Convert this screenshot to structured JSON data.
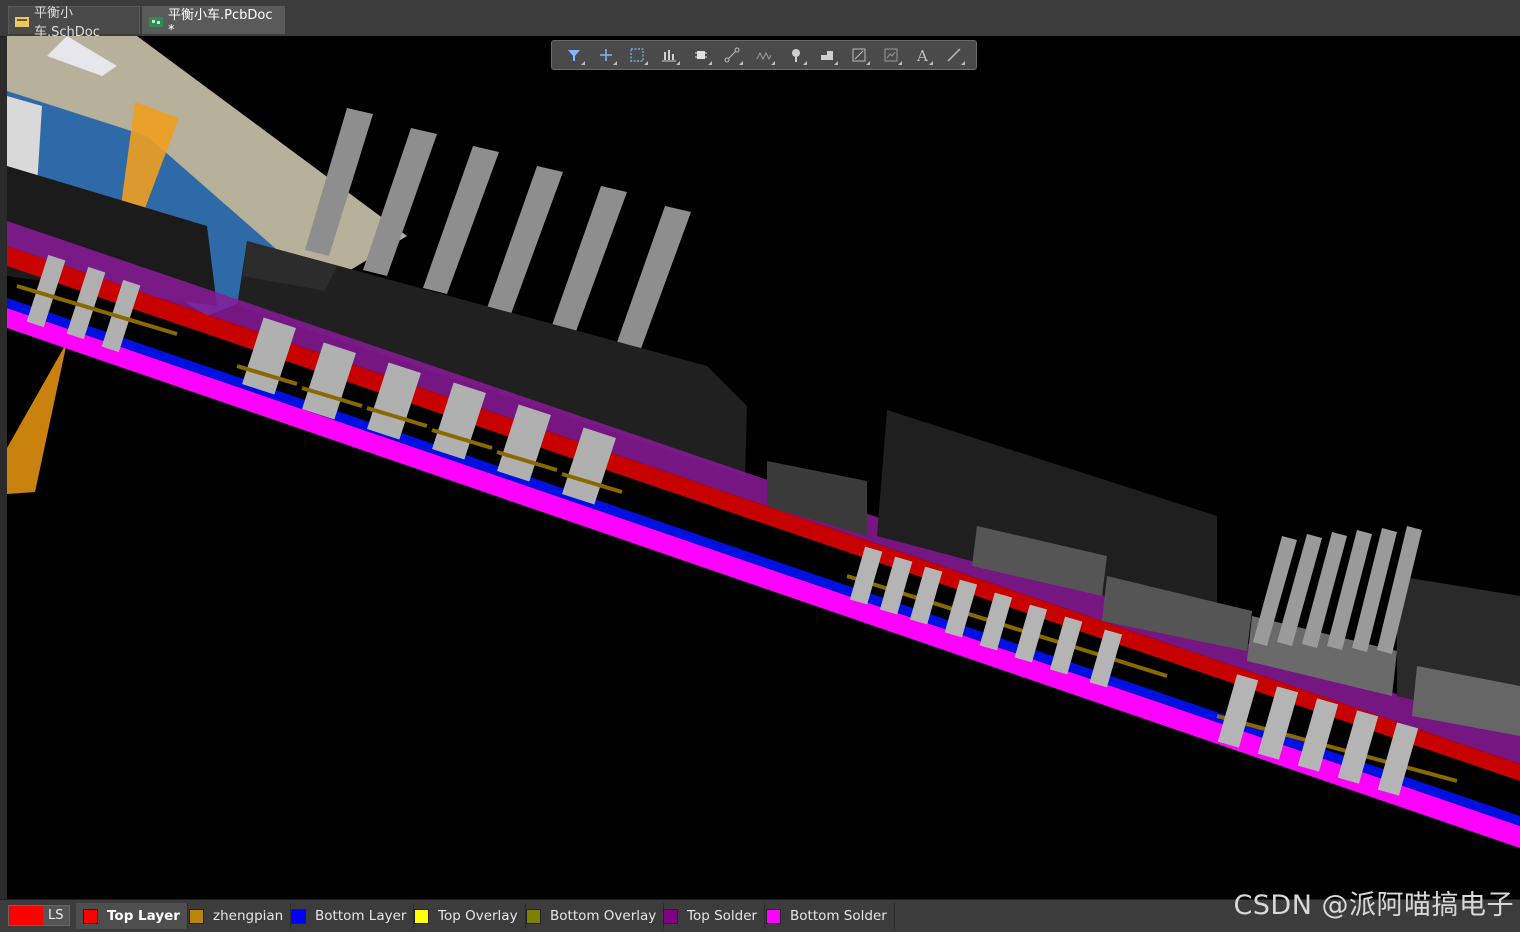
{
  "tabs": [
    {
      "label": "平衡小车.SchDoc",
      "icon": "schematic-doc-icon"
    },
    {
      "label": "平衡小车.PcbDoc *",
      "icon": "pcb-doc-icon"
    }
  ],
  "toolbar": {
    "tools": [
      {
        "name": "filter-icon"
      },
      {
        "name": "add-icon"
      },
      {
        "name": "select-rectangle-icon"
      },
      {
        "name": "align-icon"
      },
      {
        "name": "component-icon"
      },
      {
        "name": "route-icon"
      },
      {
        "name": "interactive-route-icon"
      },
      {
        "name": "pad-via-icon"
      },
      {
        "name": "polygon-icon"
      },
      {
        "name": "region-icon"
      },
      {
        "name": "dimension-icon"
      },
      {
        "name": "text-icon"
      },
      {
        "name": "line-icon"
      }
    ]
  },
  "layer_bar": {
    "ls": {
      "label": "LS",
      "color": "#ff0000"
    },
    "layers": [
      {
        "label": "Top Layer",
        "color": "#ff0000",
        "active": true
      },
      {
        "label": "zhengpian",
        "color": "#b8860b",
        "active": false
      },
      {
        "label": "Bottom Layer",
        "color": "#0000ff",
        "active": false
      },
      {
        "label": "Top Overlay",
        "color": "#ffff00",
        "active": false
      },
      {
        "label": "Bottom Overlay",
        "color": "#808000",
        "active": false
      },
      {
        "label": "Top Solder",
        "color": "#800080",
        "active": false
      },
      {
        "label": "Bottom Solder",
        "color": "#ff00ff",
        "active": false
      }
    ]
  },
  "watermark": "CSDN @派阿喵搞电子"
}
